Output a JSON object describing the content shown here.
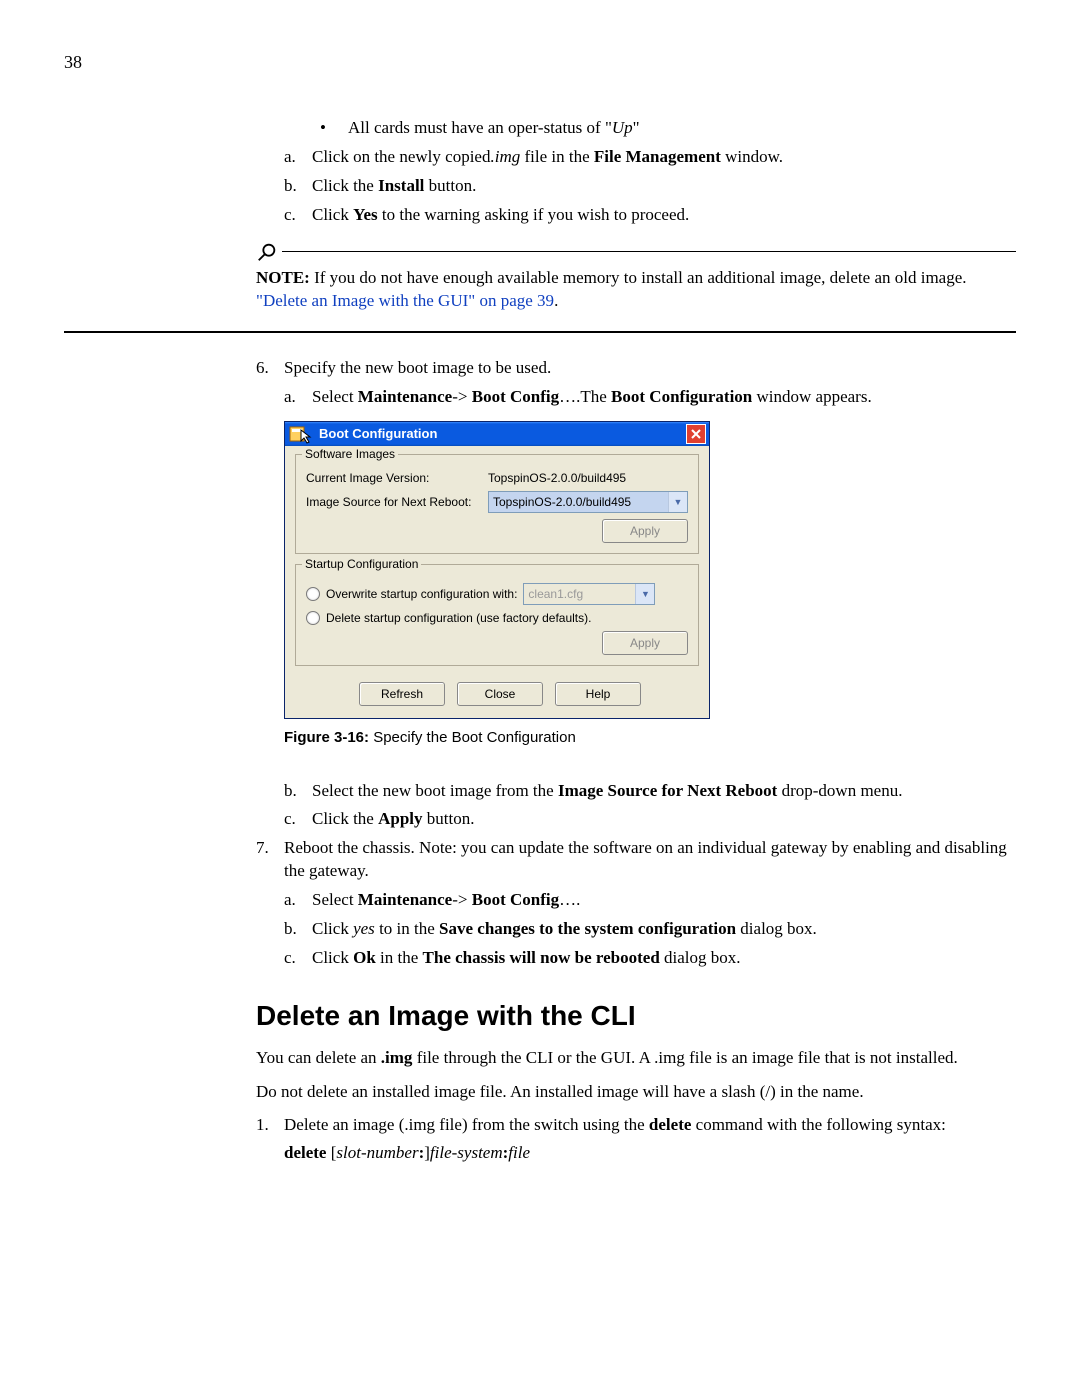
{
  "page_number": "38",
  "intro": {
    "bullet1_pre": "All cards must have an oper-status of \"",
    "bullet1_em": "Up",
    "bullet1_post": "\"",
    "a_pre": "Click on the newly copied",
    "a_em": ".img",
    "a_mid": " file in the ",
    "a_bold": "File Management",
    "a_post": " window.",
    "b_pre": "Click the ",
    "b_bold": "Install",
    "b_post": " button.",
    "c_pre": "Click ",
    "c_bold": "Yes",
    "c_post": " to the warning asking if you wish to proceed."
  },
  "note": {
    "label": "NOTE:",
    "text": "If you do not have enough available memory to install an additional image, delete an old image. ",
    "link": "\"Delete an Image with the GUI\" on page 39",
    "after": "."
  },
  "step6": {
    "num": "6.",
    "text": "Specify the new boot image to be used.",
    "a_pre": "Select ",
    "a_bold1": "Maintenance",
    "a_mid1": "-> ",
    "a_bold2": "Boot Config",
    "a_mid2": "….The ",
    "a_bold3": "Boot Configuration",
    "a_post": " window appears."
  },
  "dialog": {
    "title": "Boot Configuration",
    "group1": "Software Images",
    "civ_label": "Current Image Version:",
    "civ_value": "TopspinOS-2.0.0/build495",
    "isnr_label": "Image Source for Next Reboot:",
    "isnr_value": "TopspinOS-2.0.0/build495",
    "apply": "Apply",
    "group2": "Startup Configuration",
    "radio1": "Overwrite startup configuration with:",
    "radio1_val": "clean1.cfg",
    "radio2": "Delete startup configuration (use factory defaults).",
    "refresh": "Refresh",
    "close": "Close",
    "help": "Help"
  },
  "figcap": {
    "bold": "Figure 3-16:",
    "text": " Specify the Boot Configuration"
  },
  "step6bc": {
    "b_pre": "Select the new boot image from the ",
    "b_bold": "Image Source for Next Reboot",
    "b_post": " drop-down menu.",
    "c_pre": "Click the ",
    "c_bold": "Apply",
    "c_post": " button."
  },
  "step7": {
    "num": "7.",
    "text": "Reboot the chassis. Note: you can update the software on an individual gateway by enabling and disabling the gateway.",
    "a_pre": "Select ",
    "a_bold1": "Maintenance",
    "a_mid": "-> ",
    "a_bold2": "Boot Config",
    "a_post": "….",
    "b_pre": "Click ",
    "b_em": "yes",
    "b_mid": " to in the ",
    "b_bold": "Save changes to the system configuration",
    "b_post": " dialog box.",
    "c_pre": "Click ",
    "c_bold1": "Ok",
    "c_mid": " in the ",
    "c_bold2": "The chassis will now be rebooted",
    "c_post": " dialog box."
  },
  "section": {
    "title": "Delete an Image with the CLI",
    "p1_pre": "You can delete an ",
    "p1_bold": ".img",
    "p1_post": " file through the CLI or the GUI. A .img file is an image file that is not installed.",
    "p2": "Do not delete an installed image file. An installed image will have a slash (/) in the name.",
    "s1_num": "1.",
    "s1_pre": "Delete an image (.img file) from the switch using the ",
    "s1_bold": "delete",
    "s1_post": " command with the following syntax:",
    "syntax_bold": "delete ",
    "syntax_br1": "[",
    "syntax_i1": "slot-number",
    "syntax_b2": ":",
    "syntax_br2": "]",
    "syntax_i2": "file-system",
    "syntax_b3": ":",
    "syntax_i3": "file"
  }
}
